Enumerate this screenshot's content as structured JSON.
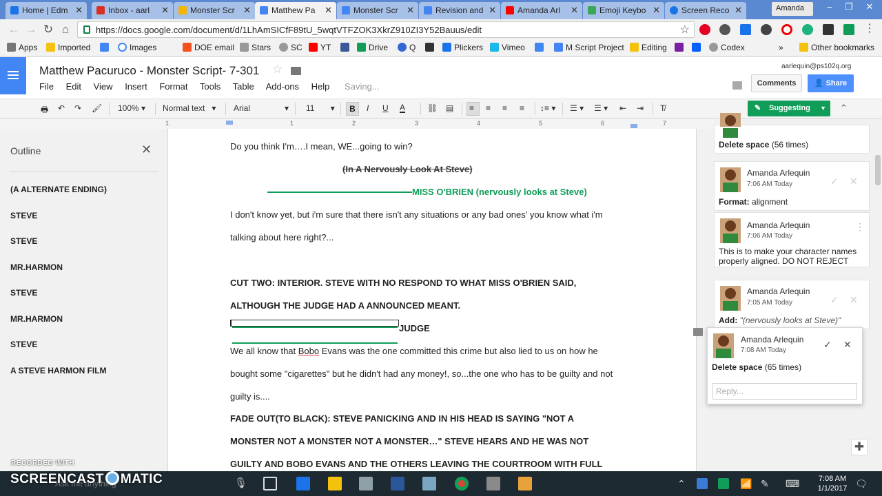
{
  "browser": {
    "tabs": [
      {
        "title": "Home | Edm",
        "color": "#1a73e8"
      },
      {
        "title": "Inbox - aarl",
        "color": "#d93025"
      },
      {
        "title": "Monster Scr",
        "color": "#f4b400"
      },
      {
        "title": "Matthew Pa",
        "color": "#4285f4"
      },
      {
        "title": "Monster Scr",
        "color": "#4285f4"
      },
      {
        "title": "Revision and",
        "color": "#4285f4"
      },
      {
        "title": "Amanda Arl",
        "color": "#ff0000"
      },
      {
        "title": "Emoji Keybo",
        "color": "#3aa757"
      },
      {
        "title": "Screen Reco",
        "color": "#1a73e8"
      }
    ],
    "user": "Amanda",
    "url": "https://docs.google.com/document/d/1LhAmSICfF89tU_5wqtVTFZOK3XkrZ910ZI3Y52Bauus/edit",
    "bookmarks": [
      {
        "label": "Apps",
        "color": "#777"
      },
      {
        "label": "Imported",
        "color": "#f4c20d"
      },
      {
        "label": "",
        "color": "#4285f4"
      },
      {
        "label": "Images",
        "color": "#4285f4"
      },
      {
        "label": "DOE email",
        "color": "#f4511e"
      },
      {
        "label": "Stars",
        "color": "#999"
      },
      {
        "label": "SC",
        "color": "#999"
      },
      {
        "label": "YT",
        "color": "#ff0000"
      },
      {
        "label": "",
        "color": "#3b5998"
      },
      {
        "label": "Drive",
        "color": "#0f9d58"
      },
      {
        "label": "Q",
        "color": "#3367d6"
      },
      {
        "label": "",
        "color": "#333"
      },
      {
        "label": "Plickers",
        "color": "#1a73e8"
      },
      {
        "label": "Vimeo",
        "color": "#1ab7ea"
      },
      {
        "label": "M Script Project",
        "color": "#4285f4"
      },
      {
        "label": "Editing",
        "color": "#f4c20d"
      },
      {
        "label": "",
        "color": "#7b1fa2"
      },
      {
        "label": "",
        "color": "#0061fe"
      },
      {
        "label": "Codex",
        "color": "#999"
      },
      {
        "label": "Other bookmarks",
        "color": "#f4c20d"
      }
    ]
  },
  "docs": {
    "title": "Matthew Pacuruco - Monster Script- 7-301",
    "menu": [
      "File",
      "Edit",
      "View",
      "Insert",
      "Format",
      "Tools",
      "Table",
      "Add-ons",
      "Help"
    ],
    "status": "Saving...",
    "account": "aarlequin@ps102q.org",
    "comments_label": "Comments",
    "share_label": "Share",
    "zoom": "100%",
    "style": "Normal text",
    "font": "Arial",
    "font_size": "11",
    "mode_label": "Suggesting",
    "ruler_numbers": [
      "1",
      "1",
      "2",
      "3",
      "4",
      "5",
      "6",
      "7"
    ]
  },
  "outline": {
    "title": "Outline",
    "items": [
      "(A ALTERNATE ENDING)",
      "STEVE",
      "STEVE",
      "MR.HARMON",
      "STEVE",
      "MR.HARMON",
      "STEVE",
      "A STEVE HARMON FILM"
    ]
  },
  "document": {
    "l1": "Do you think I'm….I mean, WE...going to win?",
    "l2": "(In A Nervously Look At Steve)",
    "l3": "MISS O'BRIEN (nervously looks at Steve)",
    "l4": "I don't know yet, but i'm sure that there isn't any situations or any bad ones' you know what i'm",
    "l5": "talking about here right?...",
    "l6": "CUT TWO: INTERIOR. STEVE WITH NO RESPOND TO WHAT MISS O'BRIEN SAID,",
    "l7": "ALTHOUGH THE JUDGE HAD A ANNOUNCED MEANT.",
    "l8": "JUDGE",
    "l9a": " We all know that ",
    "l9b": "Bobo",
    "l9c": " Evans was the one committed this crime but also lied to us on how he",
    "l10": "bought some \"cigarettes\" but he didn't had any money!, so...the one who has to be guilty and not",
    "l11": "guilty is....",
    "l12": "FADE OUT(TO BLACK): STEVE PANICKING AND IN HIS HEAD IS SAYING \"NOT A",
    "l13": "MONSTER NOT A MONSTER NOT A MONSTER…\" STEVE HEARS AND HE WAS NOT",
    "l14": "GUILTY AND BOBO EVANS AND THE OTHERS LEAVING THE COURTROOM WITH FULL"
  },
  "comments": {
    "c0_label": "Delete space",
    "c0_count": "(56 times)",
    "c1_name": "Amanda Arlequin",
    "c1_time": "7:06 AM Today",
    "c1_label": "Format:",
    "c1_value": "alignment",
    "c2_name": "Amanda Arlequin",
    "c2_time": "7:06 AM Today",
    "c2_text_line1": "This is to make your character names",
    "c2_text_line2": "properly aligned. DO NOT REJECT",
    "c3_name": "Amanda Arlequin",
    "c3_time": "7:05 AM Today",
    "c3_label": "Add:",
    "c3_value": "\"(nervously looks at Steve)\"",
    "c4_name": "Amanda Arlequin",
    "c4_time": "7:08 AM Today",
    "c4_label": "Delete space",
    "c4_count": "(65 times)",
    "reply_placeholder": "Reply..."
  },
  "taskbar": {
    "search_placeholder": "Ask me anything",
    "time": "7:08 AM",
    "date": "1/1/2017"
  },
  "watermark": {
    "small": "RECORDED WITH",
    "big_left": "SCREENCAST",
    "big_right": "MATIC"
  }
}
